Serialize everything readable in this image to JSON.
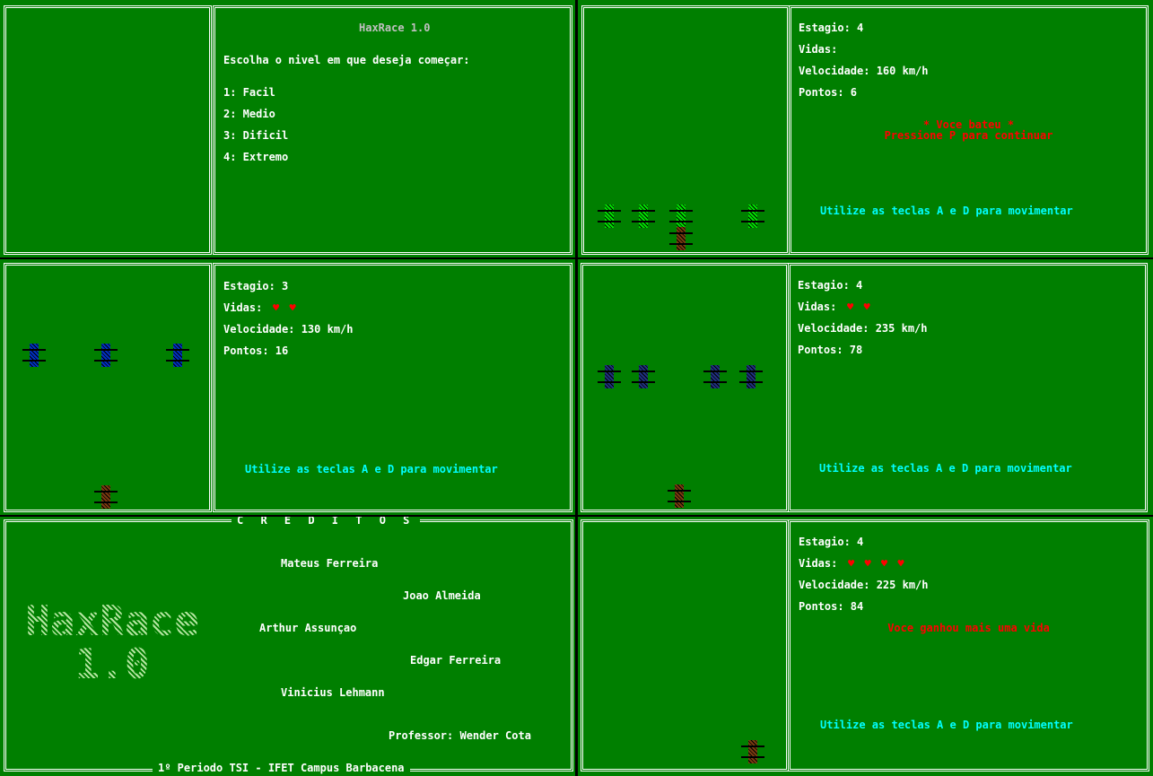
{
  "menu": {
    "title": "HaxRace 1.0",
    "prompt": "Escolha o nivel em que deseja começar:",
    "options": [
      "1: Facil",
      "2: Medio",
      "3: Dificil",
      "4: Extremo"
    ]
  },
  "game_paused": {
    "stage": "Estagio: 4",
    "lives_label": "Vidas:",
    "speed": "Velocidade: 160 km/h",
    "points": "Pontos: 6",
    "msg_lost": "* Voce bateu *",
    "msg_continue": "Pressione P para continuar",
    "hint": "Utilize as teclas A e D para movimentar"
  },
  "game_stage3": {
    "stage": "Estagio: 3",
    "lives_label": "Vidas:",
    "lives": "♥ ♥",
    "speed": "Velocidade: 130 km/h",
    "points": "Pontos: 16",
    "hint": "Utilize as teclas A e D para movimentar"
  },
  "game_stage4a": {
    "stage": "Estagio: 4",
    "lives_label": "Vidas:",
    "lives": "♥ ♥",
    "speed": "Velocidade: 235 km/h",
    "points": "Pontos: 78",
    "hint": "Utilize as teclas A e D para movimentar"
  },
  "credits": {
    "heading": "C R E D I T O S",
    "logo_line1": "HaxRace",
    "logo_line2": "1.0",
    "names": [
      "Mateus Ferreira",
      "Joao Almeida",
      "Arthur Assunçao",
      "Edgar Ferreira",
      "Vinicius Lehmann"
    ],
    "professor": "Professor: Wender Cota",
    "footer": "1º Periodo TSI - IFET Campus Barbacena"
  },
  "game_stage4b": {
    "stage": "Estagio: 4",
    "lives_label": "Vidas:",
    "lives": "♥ ♥ ♥ ♥",
    "speed": "Velocidade: 225 km/h",
    "points": "Pontos: 84",
    "msg_extra_life": "Voce ganhou mais uma vida",
    "hint": "Utilize as teclas A e D para movimentar"
  },
  "colors": {
    "field": "#007f00",
    "player_car": "#7a3a10",
    "enemy_green": "#00e000",
    "enemy_blue": "#0030c0",
    "enemy_darkblue": "#203080",
    "hint": "#00ffff",
    "alert": "#ff0000"
  }
}
